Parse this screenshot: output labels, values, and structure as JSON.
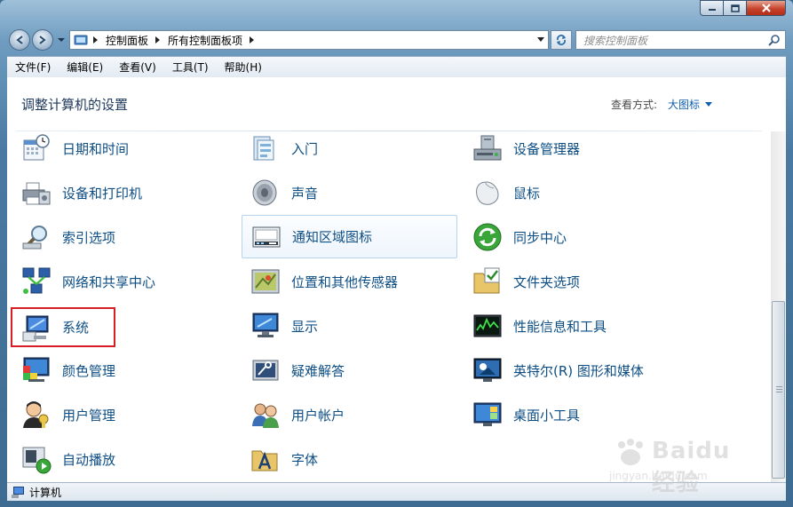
{
  "window": {
    "caption_buttons": [
      "minimize-icon",
      "maximize-icon",
      "close-icon"
    ]
  },
  "nav": {
    "breadcrumbs": [
      "控制面板",
      "所有控制面板项"
    ],
    "search_placeholder": "搜索控制面板"
  },
  "menu": [
    "文件(F)",
    "编辑(E)",
    "查看(V)",
    "工具(T)",
    "帮助(H)"
  ],
  "content": {
    "heading": "调整计算机的设置",
    "view_by_label": "查看方式:",
    "view_by_value": "大图标"
  },
  "items": [
    {
      "label": "日期和时间",
      "icon": "calendar-clock-icon"
    },
    {
      "label": "入门",
      "icon": "getting-started-icon"
    },
    {
      "label": "设备管理器",
      "icon": "device-manager-icon"
    },
    {
      "label": "设备和打印机",
      "icon": "printer-icon"
    },
    {
      "label": "声音",
      "icon": "speaker-icon"
    },
    {
      "label": "鼠标",
      "icon": "mouse-icon"
    },
    {
      "label": "索引选项",
      "icon": "index-search-icon"
    },
    {
      "label": "通知区域图标",
      "icon": "notification-area-icon"
    },
    {
      "label": "同步中心",
      "icon": "sync-center-icon"
    },
    {
      "label": "网络和共享中心",
      "icon": "network-icon"
    },
    {
      "label": "位置和其他传感器",
      "icon": "location-sensor-icon"
    },
    {
      "label": "文件夹选项",
      "icon": "folder-options-icon"
    },
    {
      "label": "系统",
      "icon": "system-icon"
    },
    {
      "label": "显示",
      "icon": "display-icon"
    },
    {
      "label": "性能信息和工具",
      "icon": "performance-icon"
    },
    {
      "label": "颜色管理",
      "icon": "color-management-icon"
    },
    {
      "label": "疑难解答",
      "icon": "troubleshooting-icon"
    },
    {
      "label": "英特尔(R) 图形和媒体",
      "icon": "intel-graphics-icon"
    },
    {
      "label": "用户管理",
      "icon": "user-management-icon"
    },
    {
      "label": "用户帐户",
      "icon": "user-accounts-icon"
    },
    {
      "label": "桌面小工具",
      "icon": "gadgets-icon"
    },
    {
      "label": "自动播放",
      "icon": "autoplay-icon"
    },
    {
      "label": "字体",
      "icon": "fonts-icon"
    }
  ],
  "status": {
    "label": "计算机",
    "icon": "computer-icon"
  },
  "watermark": {
    "text": "Baidu 经验",
    "url": "jingyan.baidu.com"
  },
  "colors": {
    "item_label": "#0d4e84",
    "highlight_border": "#d51f24",
    "heading": "#1e395b"
  }
}
